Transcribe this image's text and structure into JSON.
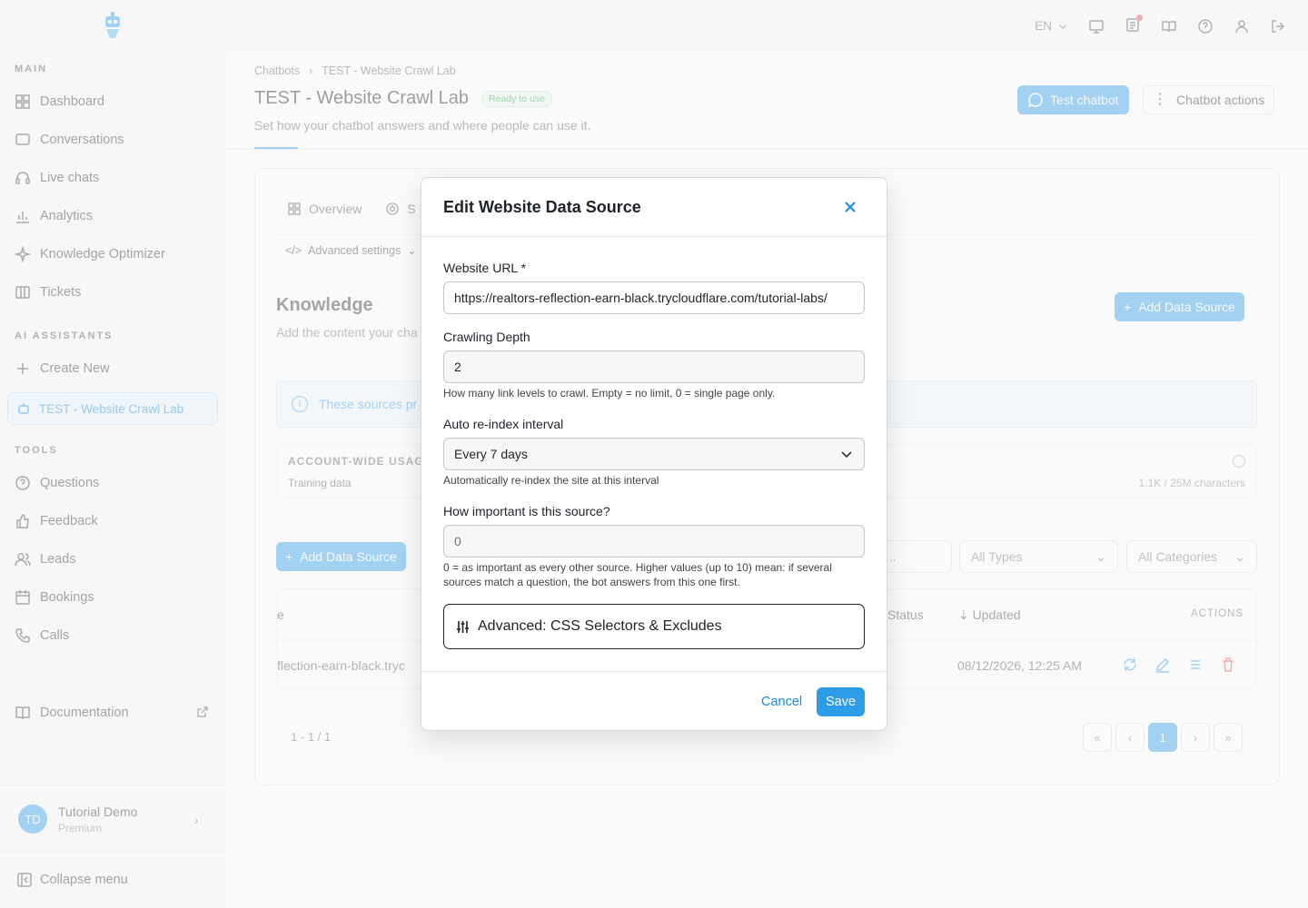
{
  "sidebar": {
    "section_main": "MAIN",
    "main_items": [
      {
        "label": "Dashboard",
        "icon": "dashboard-icon"
      },
      {
        "label": "Conversations",
        "icon": "chat-icon"
      },
      {
        "label": "Live chats",
        "icon": "headset-icon"
      },
      {
        "label": "Analytics",
        "icon": "analytics-icon"
      },
      {
        "label": "Knowledge Optimizer",
        "icon": "sparkle-icon"
      },
      {
        "label": "Tickets",
        "icon": "tickets-icon"
      }
    ],
    "section_assistants": "AI ASSISTANTS",
    "create_new": "Create New",
    "active_assistant": "TEST - Website Crawl Lab",
    "section_tools": "TOOLS",
    "tool_items": [
      {
        "label": "Questions",
        "icon": "question-icon"
      },
      {
        "label": "Feedback",
        "icon": "thumbs-up-icon"
      },
      {
        "label": "Leads",
        "icon": "users-icon"
      },
      {
        "label": "Bookings",
        "icon": "calendar-icon"
      },
      {
        "label": "Calls",
        "icon": "phone-icon"
      }
    ],
    "documentation": "Documentation",
    "user": {
      "initials": "TD",
      "name": "Tutorial Demo",
      "plan": "Premium"
    },
    "collapse": "Collapse menu"
  },
  "topbar": {
    "language": "EN"
  },
  "header": {
    "breadcrumb": [
      "Chatbots",
      "TEST - Website Crawl Lab"
    ],
    "title": "TEST - Website Crawl Lab",
    "status_badge": "Ready to use",
    "subtitle": "Set how your chatbot answers and where people can use it.",
    "test_button": "Test chatbot",
    "actions_button": "Chatbot actions"
  },
  "content": {
    "tabs": [
      "Overview",
      "S"
    ],
    "advanced_settings": "Advanced settings",
    "knowledge_title": "Knowledge",
    "knowledge_subtitle": "Add the content your cha",
    "add_source_button": "Add Data Source",
    "info_text": "These sources pr",
    "usage_title": "ACCOUNT-WIDE USAGE",
    "usage_label": "Training data",
    "usage_value": "1.1K / 25M characters",
    "filters": {
      "search_placeholder": "...",
      "types": "All Types",
      "categories": "All Categories"
    },
    "table": {
      "headers": {
        "name": "e",
        "status": "Status",
        "updated": "Updated",
        "actions": "ACTIONS"
      },
      "row": {
        "name": "flection-earn-black.tryc",
        "updated": "08/12/2026, 12:25 AM"
      }
    },
    "pager": {
      "count": "1 - 1 / 1",
      "current": "1"
    }
  },
  "modal": {
    "title": "Edit Website Data Source",
    "url_label": "Website URL *",
    "url_value": "https://realtors-reflection-earn-black.trycloudflare.com/tutorial-labs/",
    "depth_label": "Crawling Depth",
    "depth_value": "2",
    "depth_help": "How many link levels to crawl. Empty = no limit, 0 = single page only.",
    "reindex_label": "Auto re-index interval",
    "reindex_value": "Every 7 days",
    "reindex_help": "Automatically re-index the site at this interval",
    "importance_label": "How important is this source?",
    "importance_placeholder": "0",
    "importance_help": "0 = as important as every other source. Higher values (up to 10) mean: if several sources match a question, the bot answers from this one first.",
    "advanced_label": "Advanced: CSS Selectors & Excludes",
    "cancel": "Cancel",
    "save": "Save"
  },
  "colors": {
    "accent": "#2e9de8",
    "accent_dark": "#1a8cd8",
    "success": "#22a34a",
    "danger": "#e44d4d"
  }
}
